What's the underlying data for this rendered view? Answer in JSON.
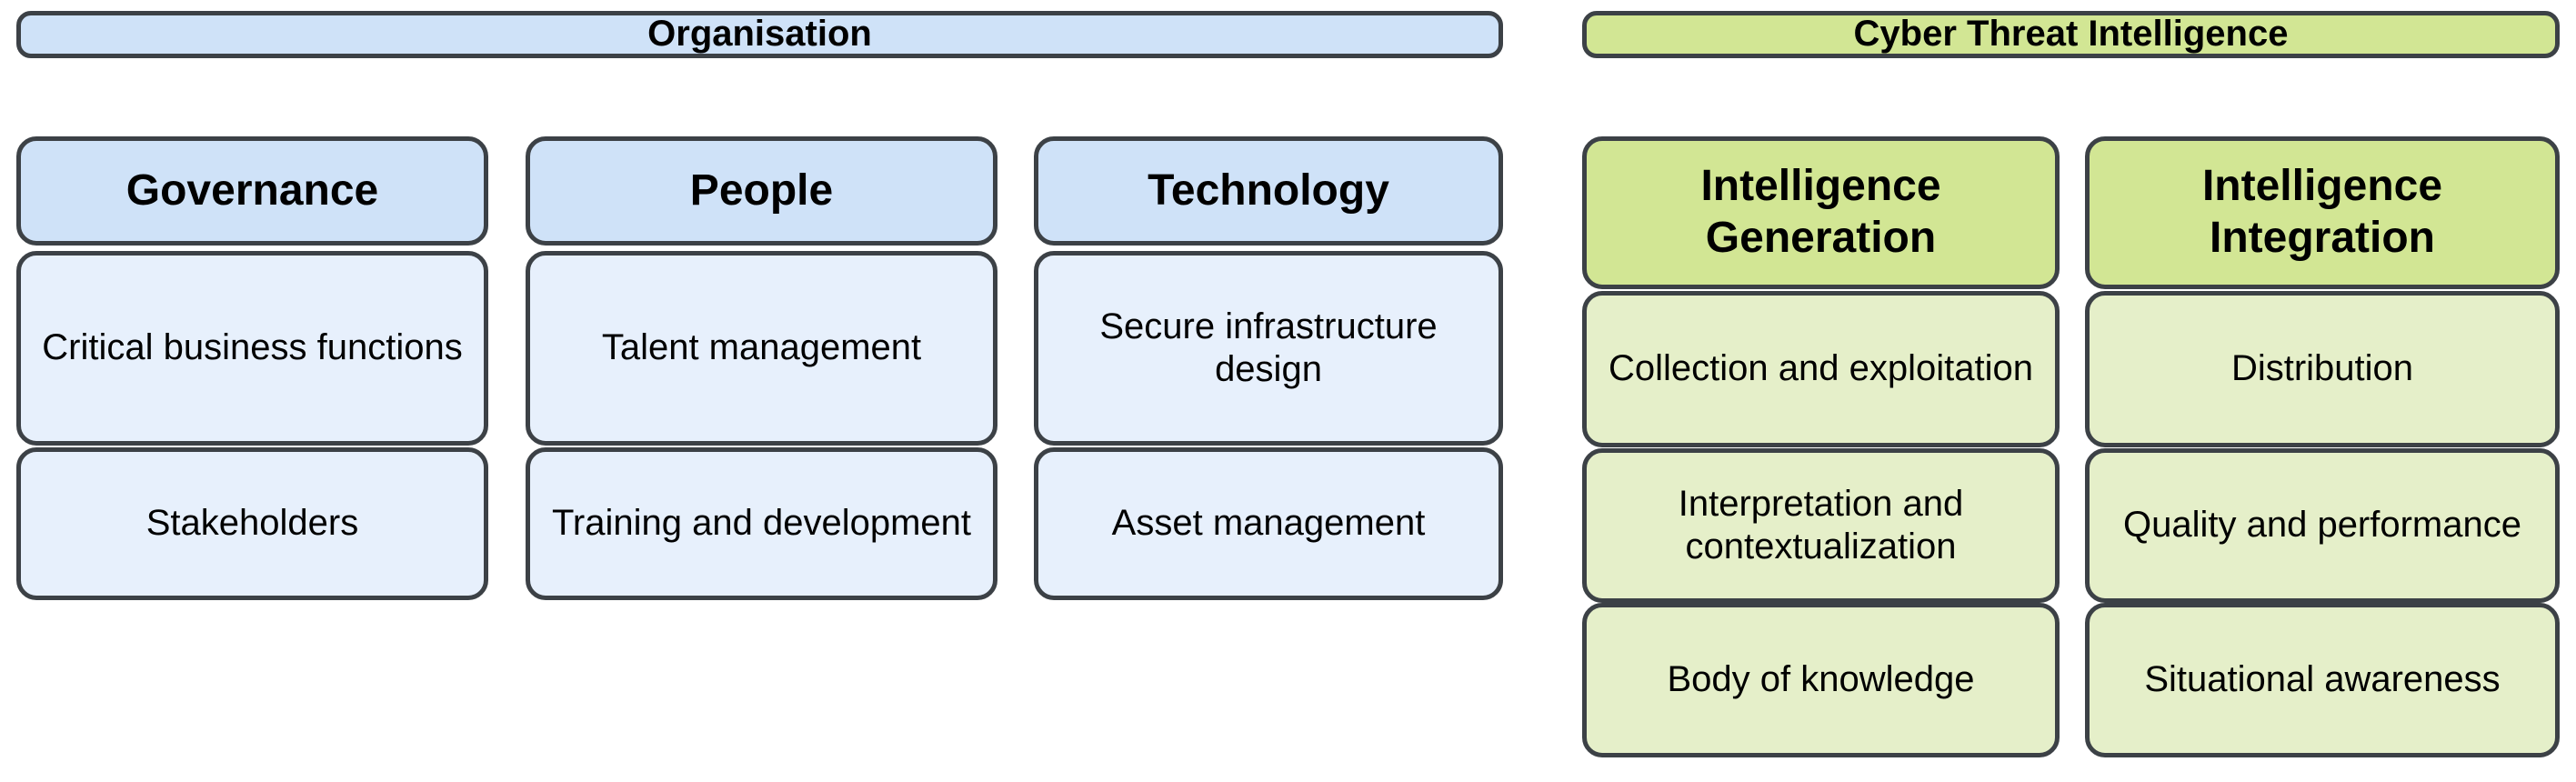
{
  "diagram": {
    "title_hidden": "",
    "groups": [
      {
        "id": "organisation",
        "banner": "Organisation",
        "accent_header": "#cfe2f8",
        "accent_cell": "#e7f0fc",
        "columns": [
          {
            "title": "Governance",
            "items": [
              "Critical business functions",
              "Stakeholders"
            ]
          },
          {
            "title": "People",
            "items": [
              "Talent management",
              "Training and development"
            ]
          },
          {
            "title": "Technology",
            "items": [
              "Secure infrastructure design",
              "Asset management"
            ]
          }
        ]
      },
      {
        "id": "cyber-threat-intelligence",
        "banner": "Cyber Threat Intelligence",
        "accent_header": "#d2e694",
        "accent_cell": "#e5efc9",
        "columns": [
          {
            "title": "Intelligence Generation",
            "items": [
              "Collection and exploitation",
              "Interpretation and contextualization",
              "Body of knowledge"
            ]
          },
          {
            "title": "Intelligence Integration",
            "items": [
              "Distribution",
              "Quality and performance",
              "Situational awareness"
            ]
          }
        ]
      }
    ],
    "colors": {
      "border": "#3c4146",
      "text": "#000000",
      "background": "#ffffff",
      "blue_header": "#cfe2f8",
      "blue_cell": "#e7f0fc",
      "green_header": "#d2e694",
      "green_cell": "#e5efc9"
    }
  }
}
